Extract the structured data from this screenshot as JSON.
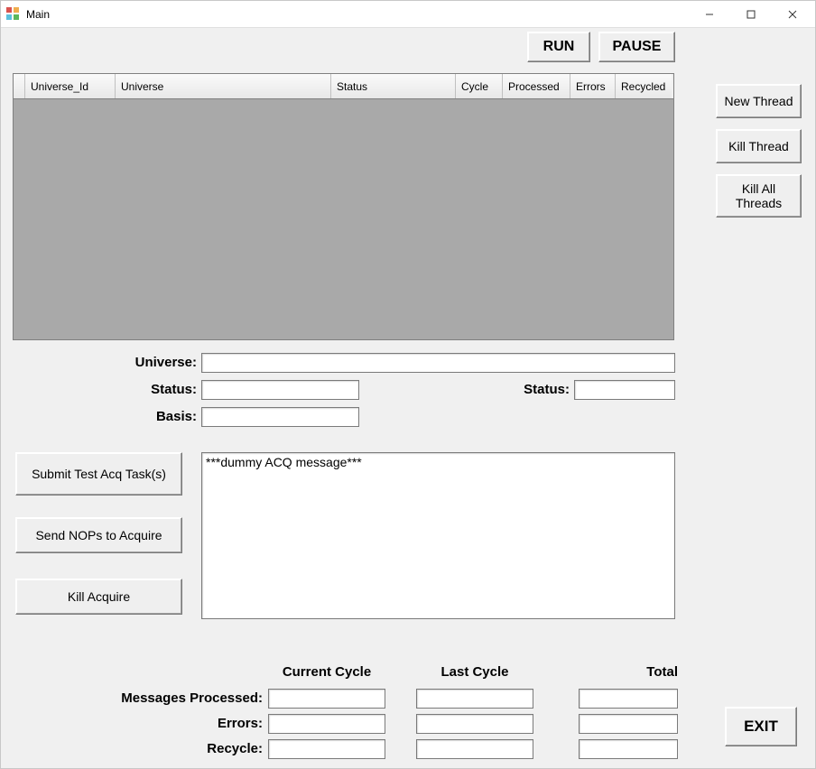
{
  "title": "Main",
  "toolbar": {
    "run": "RUN",
    "pause": "PAUSE"
  },
  "thread_buttons": {
    "new": "New Thread",
    "kill": "Kill Thread",
    "kill_all": "Kill All Threads"
  },
  "grid": {
    "columns": [
      "Universe_Id",
      "Universe",
      "Status",
      "Cycle",
      "Processed",
      "Errors",
      "Recycled"
    ]
  },
  "fields": {
    "universe_label": "Universe:",
    "universe_value": "",
    "status_label": "Status:",
    "status_value": "",
    "basis_label": "Basis:",
    "basis_value": "",
    "status2_label": "Status:",
    "status2_value": ""
  },
  "acq_buttons": {
    "submit": "Submit Test Acq Task(s)",
    "send_nops": "Send NOPs to Acquire",
    "kill_acquire": "Kill Acquire"
  },
  "log": "***dummy ACQ message***",
  "stats": {
    "col_current": "Current Cycle",
    "col_last": "Last Cycle",
    "col_total": "Total",
    "row_msgs": "Messages Processed:",
    "row_errors": "Errors:",
    "row_recycle": "Recycle:",
    "msgs": {
      "cur": "",
      "last": "",
      "total": ""
    },
    "errors": {
      "cur": "",
      "last": "",
      "total": ""
    },
    "recycle": {
      "cur": "",
      "last": "",
      "total": ""
    }
  },
  "exit_label": "EXIT"
}
